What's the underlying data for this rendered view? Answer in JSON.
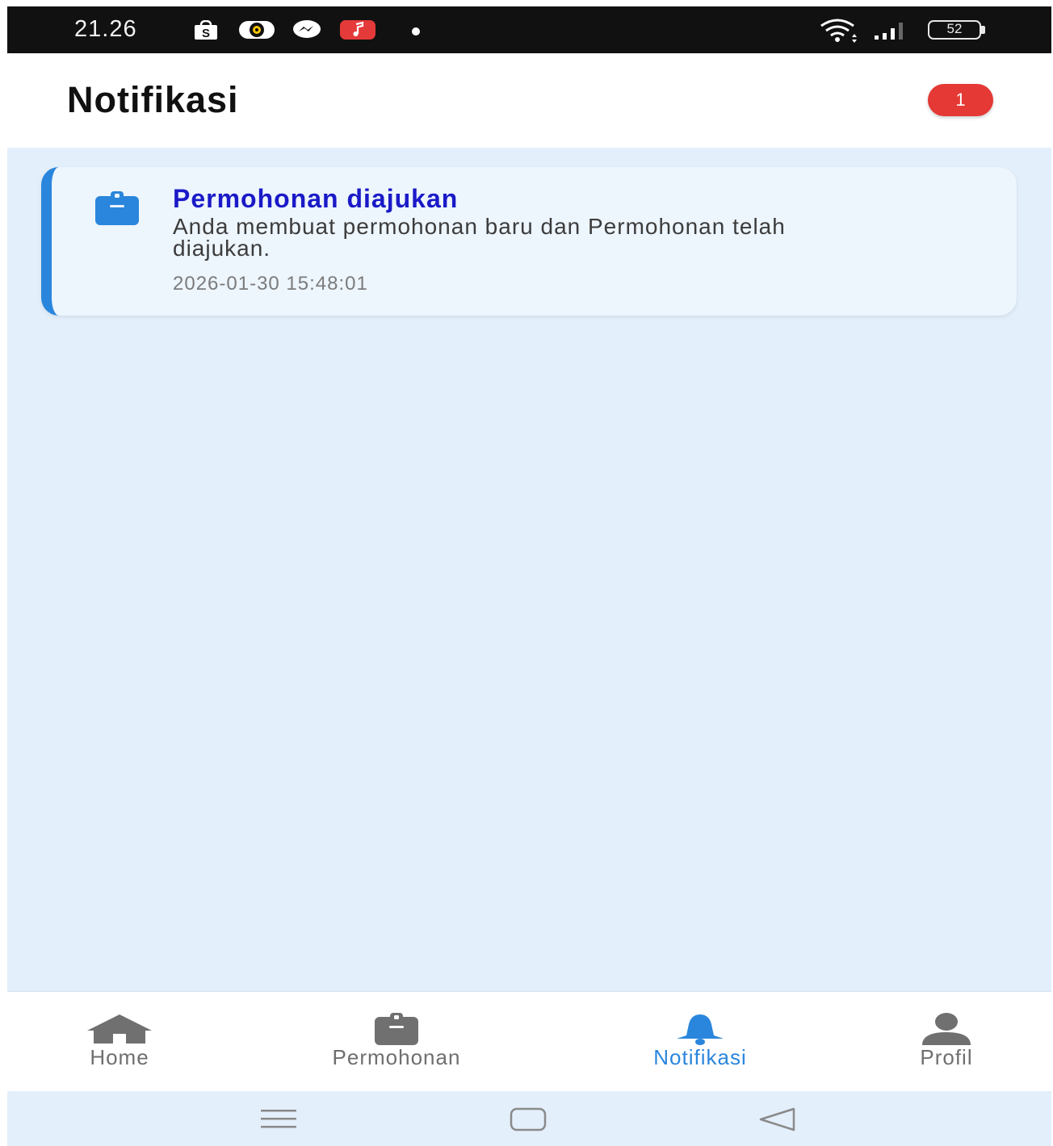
{
  "status_bar": {
    "time": "21.26",
    "battery": "52",
    "icons": [
      "shop-icon",
      "disc-icon",
      "messenger-icon",
      "music-icon",
      "dot-icon",
      "wifi-icon",
      "signal-icon",
      "battery-icon"
    ]
  },
  "header": {
    "title": "Notifikasi",
    "badge_count": "1"
  },
  "notifications": [
    {
      "icon": "clipboard-icon",
      "title": "Permohonan diajukan",
      "message": "Anda membuat permohonan baru dan Permohonan telah diajukan.",
      "timestamp": "2026-01-30 15:48:01"
    }
  ],
  "bottom_nav": {
    "items": [
      {
        "label": "Home",
        "icon": "home-icon",
        "active": false
      },
      {
        "label": "Permohonan",
        "icon": "clipboard-icon",
        "active": false
      },
      {
        "label": "Notifikasi",
        "icon": "bell-icon",
        "active": true
      },
      {
        "label": "Profil",
        "icon": "person-icon",
        "active": false
      }
    ]
  },
  "colors": {
    "accent": "#2a86dc",
    "title_blue": "#1a1ac8",
    "badge_red": "#e53935",
    "background": "#e3effb",
    "inactive_nav": "#6f6f6f"
  },
  "system_nav": [
    "menu-icon",
    "home-square-icon",
    "back-icon"
  ]
}
